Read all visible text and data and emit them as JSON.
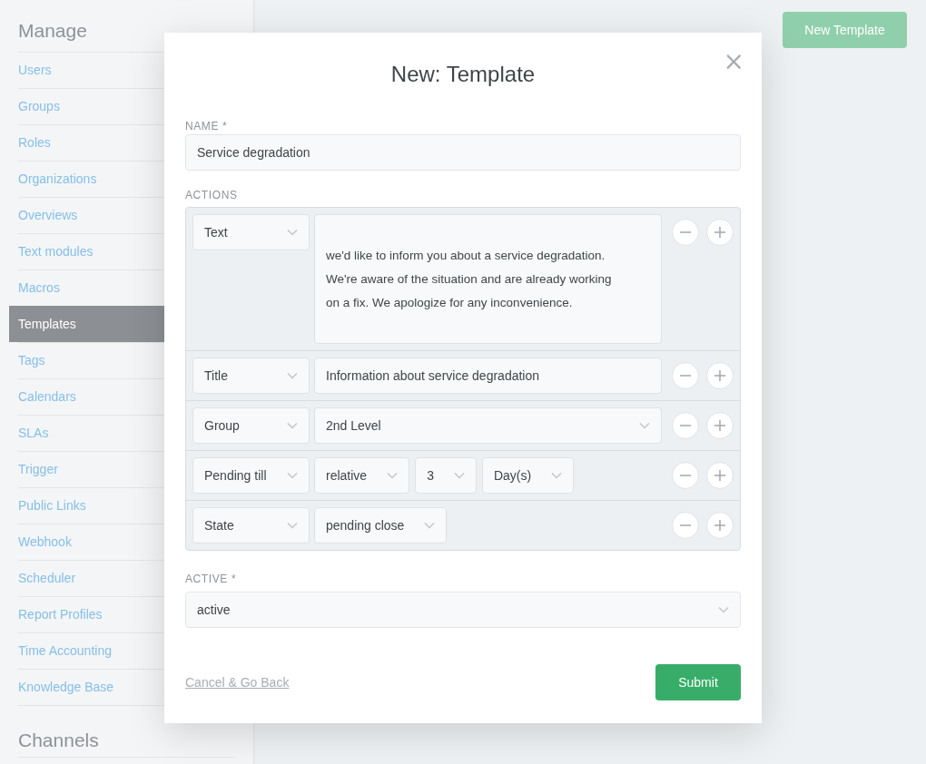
{
  "sidebar": {
    "heading": "Manage",
    "items": [
      {
        "label": "Users",
        "selected": false
      },
      {
        "label": "Groups",
        "selected": false
      },
      {
        "label": "Roles",
        "selected": false
      },
      {
        "label": "Organizations",
        "selected": false
      },
      {
        "label": "Overviews",
        "selected": false
      },
      {
        "label": "Text modules",
        "selected": false
      },
      {
        "label": "Macros",
        "selected": false
      },
      {
        "label": "Templates",
        "selected": true
      },
      {
        "label": "Tags",
        "selected": false
      },
      {
        "label": "Calendars",
        "selected": false
      },
      {
        "label": "SLAs",
        "selected": false
      },
      {
        "label": "Trigger",
        "selected": false
      },
      {
        "label": "Public Links",
        "selected": false
      },
      {
        "label": "Webhook",
        "selected": false
      },
      {
        "label": "Scheduler",
        "selected": false
      },
      {
        "label": "Report Profiles",
        "selected": false
      },
      {
        "label": "Time Accounting",
        "selected": false
      },
      {
        "label": "Knowledge Base",
        "selected": false
      }
    ],
    "section_heading": "Channels"
  },
  "page": {
    "new_button": "New Template"
  },
  "modal": {
    "title": "New: Template",
    "close": "×",
    "name_label": "NAME *",
    "name_value": "Service degradation",
    "actions_label": "ACTIONS",
    "actions": [
      {
        "attribute": "Text",
        "fields": [
          {
            "kind": "textarea",
            "value": "we'd like to inform you about a service degradation.\nWe're aware of the situation and are already working\non a fix. We apologize for any inconvenience."
          }
        ]
      },
      {
        "attribute": "Title",
        "fields": [
          {
            "kind": "input",
            "value": "Information about service degradation"
          }
        ]
      },
      {
        "attribute": "Group",
        "fields": [
          {
            "kind": "select",
            "value": "2nd Level"
          }
        ]
      },
      {
        "attribute": "Pending till",
        "fields": [
          {
            "kind": "compact",
            "value": "relative"
          },
          {
            "kind": "compact",
            "value": "3"
          },
          {
            "kind": "compact",
            "value": "Day(s)"
          }
        ]
      },
      {
        "attribute": "State",
        "fields": [
          {
            "kind": "compact",
            "value": "pending close"
          }
        ]
      }
    ],
    "active_label": "ACTIVE *",
    "active_value": "active",
    "cancel": "Cancel & Go Back",
    "submit": "Submit"
  }
}
